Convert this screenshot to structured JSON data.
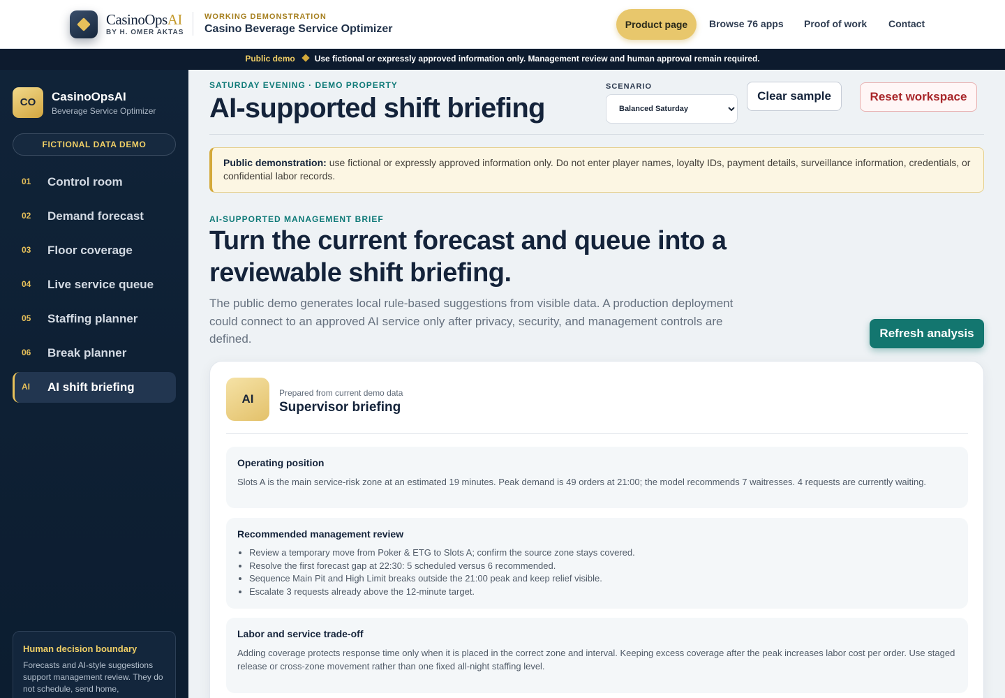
{
  "header": {
    "brand_main": "CasinoOps",
    "brand_ai": "AI",
    "brand_by": "BY H. OMER AKTAS",
    "demo_kicker": "WORKING DEMONSTRATION",
    "demo_title": "Casino Beverage Service Optimizer",
    "nav": {
      "product": "Product page",
      "browse": "Browse 76 apps",
      "proof": "Proof of work",
      "contact": "Contact"
    }
  },
  "demobar": {
    "lead": "Public demo",
    "text": "Use fictional or expressly approved information only. Management review and human approval remain required."
  },
  "sidebar": {
    "logo_text": "CO",
    "title": "CasinoOpsAI",
    "subtitle": "Beverage Service Optimizer",
    "badge": "FICTIONAL DATA DEMO",
    "items": [
      {
        "num": "01",
        "label": "Control room"
      },
      {
        "num": "02",
        "label": "Demand forecast"
      },
      {
        "num": "03",
        "label": "Floor coverage"
      },
      {
        "num": "04",
        "label": "Live service queue"
      },
      {
        "num": "05",
        "label": "Staffing planner"
      },
      {
        "num": "06",
        "label": "Break planner"
      },
      {
        "num": "AI",
        "label": "AI shift briefing"
      }
    ],
    "active_index": 6,
    "boundary_title": "Human decision boundary",
    "boundary_text": "Forecasts and AI-style suggestions support management review. They do not schedule, send home,"
  },
  "main": {
    "kicker": "SATURDAY EVENING · DEMO PROPERTY",
    "title": "AI-supported shift briefing",
    "scenario_label": "SCENARIO",
    "scenario_value": "Balanced Saturday",
    "clear_label": "Clear sample",
    "reset_label": "Reset workspace",
    "notice_lead": "Public demonstration:",
    "notice_text": "use fictional or expressly approved information only. Do not enter player names, loyalty IDs, payment details, surveillance information, credentials, or confidential labor records.",
    "brief_kicker": "AI-SUPPORTED MANAGEMENT BRIEF",
    "hero_title": "Turn the current forecast and queue into a reviewable shift briefing.",
    "hero_body": "The public demo generates local rule-based suggestions from visible data. A production deployment could connect to an approved AI service only after privacy, security, and management controls are defined.",
    "refresh_label": "Refresh analysis"
  },
  "card": {
    "badge": "AI",
    "sup": "Prepared from current demo data",
    "title": "Supervisor briefing",
    "sections": {
      "operating": {
        "title": "Operating position",
        "text": "Slots A is the main service-risk zone at an estimated 19 minutes. Peak demand is 49 orders at 21:00; the model recommends 7 waitresses. 4 requests are currently waiting."
      },
      "review": {
        "title": "Recommended management review",
        "items": [
          "Review a temporary move from Poker & ETG to Slots A; confirm the source zone stays covered.",
          "Resolve the first forecast gap at 22:30: 5 scheduled versus 6 recommended.",
          "Sequence Main Pit and High Limit breaks outside the 21:00 peak and keep relief visible.",
          "Escalate 3 requests already above the 12-minute target."
        ]
      },
      "tradeoff": {
        "title": "Labor and service trade-off",
        "text": "Adding coverage protects response time only when it is placed in the correct zone and interval. Keeping excess coverage after the peak increases labor cost per order. Use staged release or cross-zone movement rather than one fixed all-night staffing level."
      }
    }
  }
}
